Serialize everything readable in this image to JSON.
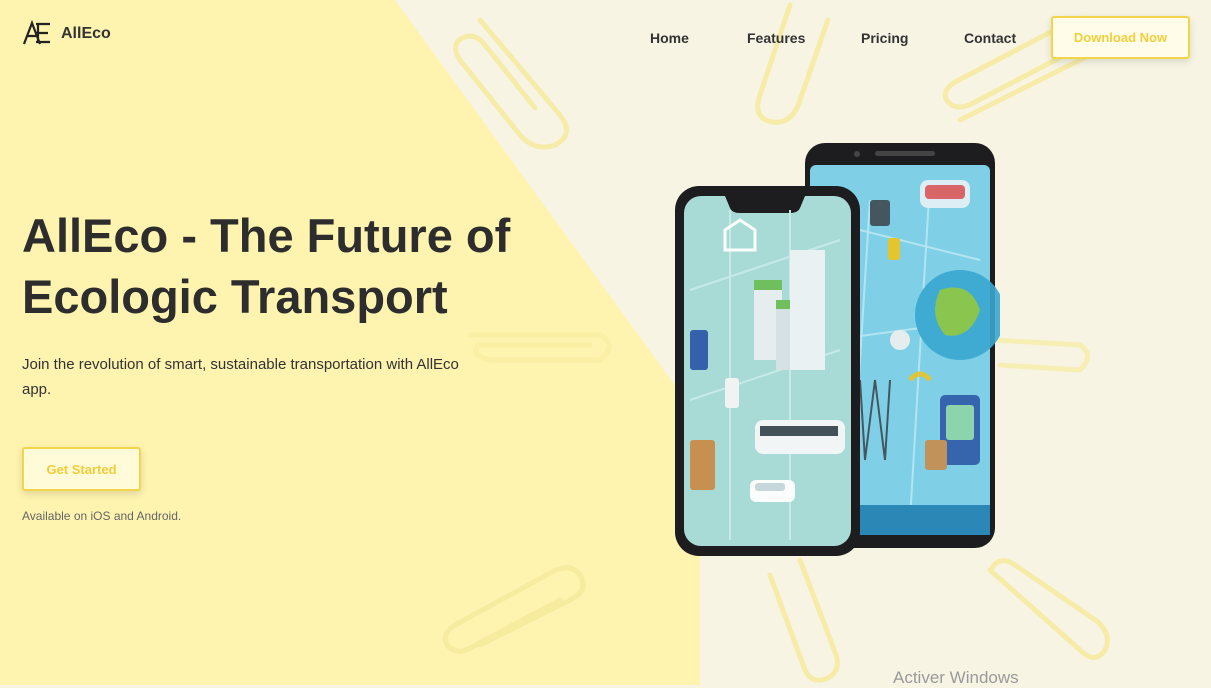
{
  "brand": {
    "name": "AllEco",
    "logo_mark": "AE"
  },
  "nav": {
    "items": [
      {
        "label": "Home"
      },
      {
        "label": "Features"
      },
      {
        "label": "Pricing"
      },
      {
        "label": "Contact"
      }
    ],
    "download_label": "Download Now"
  },
  "hero": {
    "title": "AllEco - The Future of Ecologic Transport",
    "subtitle": "Join the revolution of smart, sustainable transportation with AllEco app.",
    "cta_label": "Get Started",
    "availability": "Available on iOS and Android."
  },
  "watermark": "Activer Windows",
  "colors": {
    "accent": "#f2d54a",
    "background": "#f7f4e3",
    "panel": "#fff2a6",
    "text": "#2d2d2d"
  }
}
